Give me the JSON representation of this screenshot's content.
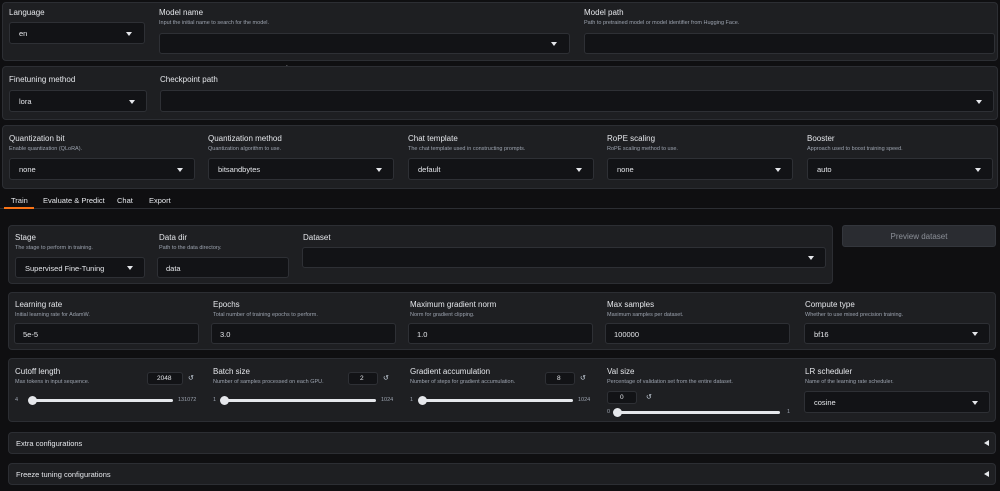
{
  "top": {
    "language": {
      "label": "Language",
      "value": "en"
    },
    "model_name": {
      "label": "Model name",
      "info": "Input the initial name to search for the model.",
      "value": ""
    },
    "model_path": {
      "label": "Model path",
      "info": "Path to pretrained model or model identifier from Hugging Face.",
      "value": ""
    }
  },
  "finetune": {
    "method": {
      "label": "Finetuning method",
      "value": "lora"
    },
    "checkpoint": {
      "label": "Checkpoint path",
      "value": ""
    }
  },
  "advanced": {
    "quant_bit": {
      "label": "Quantization bit",
      "info": "Enable quantization (QLoRA).",
      "value": "none"
    },
    "quant_method": {
      "label": "Quantization method",
      "info": "Quantization algorithm to use.",
      "value": "bitsandbytes"
    },
    "template": {
      "label": "Chat template",
      "info": "The chat template used in constructing prompts.",
      "value": "default"
    },
    "rope": {
      "label": "RoPE scaling",
      "info": "RoPE scaling method to use.",
      "value": "none"
    },
    "booster": {
      "label": "Booster",
      "info": "Approach used to boost training speed.",
      "value": "auto"
    }
  },
  "tabs": [
    {
      "label": "Train",
      "active": true
    },
    {
      "label": "Evaluate & Predict",
      "active": false
    },
    {
      "label": "Chat",
      "active": false
    },
    {
      "label": "Export",
      "active": false
    }
  ],
  "train": {
    "stage": {
      "label": "Stage",
      "info": "The stage to perform in training.",
      "value": "Supervised Fine-Tuning"
    },
    "data_dir": {
      "label": "Data dir",
      "info": "Path to the data directory.",
      "value": "data"
    },
    "dataset": {
      "label": "Dataset",
      "value": ""
    },
    "preview_button": "Preview dataset",
    "learning_rate": {
      "label": "Learning rate",
      "info": "Initial learning rate for AdamW.",
      "value": "5e-5"
    },
    "epochs": {
      "label": "Epochs",
      "info": "Total number of training epochs to perform.",
      "value": "3.0"
    },
    "max_grad_norm": {
      "label": "Maximum gradient norm",
      "info": "Norm for gradient clipping.",
      "value": "1.0"
    },
    "max_samples": {
      "label": "Max samples",
      "info": "Maximum samples per dataset.",
      "value": "100000"
    },
    "compute_type": {
      "label": "Compute type",
      "info": "Whether to use mixed precision training.",
      "value": "bf16"
    },
    "cutoff_len": {
      "label": "Cutoff length",
      "info": "Max tokens in input sequence.",
      "value": "2048",
      "min": "4",
      "max": "131072",
      "fraction": 0.016
    },
    "batch_size": {
      "label": "Batch size",
      "info": "Number of samples processed on each GPU.",
      "value": "2",
      "min": "1",
      "max": "1024",
      "fraction": 0.001
    },
    "grad_accum": {
      "label": "Gradient accumulation",
      "info": "Number of steps for gradient accumulation.",
      "value": "8",
      "min": "1",
      "max": "1024",
      "fraction": 0.007
    },
    "val_size": {
      "label": "Val size",
      "info": "Percentage of validation set from the entire dataset.",
      "value": "0",
      "min": "0",
      "max": "1",
      "fraction": 0.0
    },
    "lr_scheduler": {
      "label": "LR scheduler",
      "info": "Name of the learning rate scheduler.",
      "value": "cosine"
    }
  },
  "accordions": {
    "extra": "Extra configurations",
    "freeze": "Freeze tuning configurations"
  },
  "icons": {
    "reset": "↺"
  }
}
